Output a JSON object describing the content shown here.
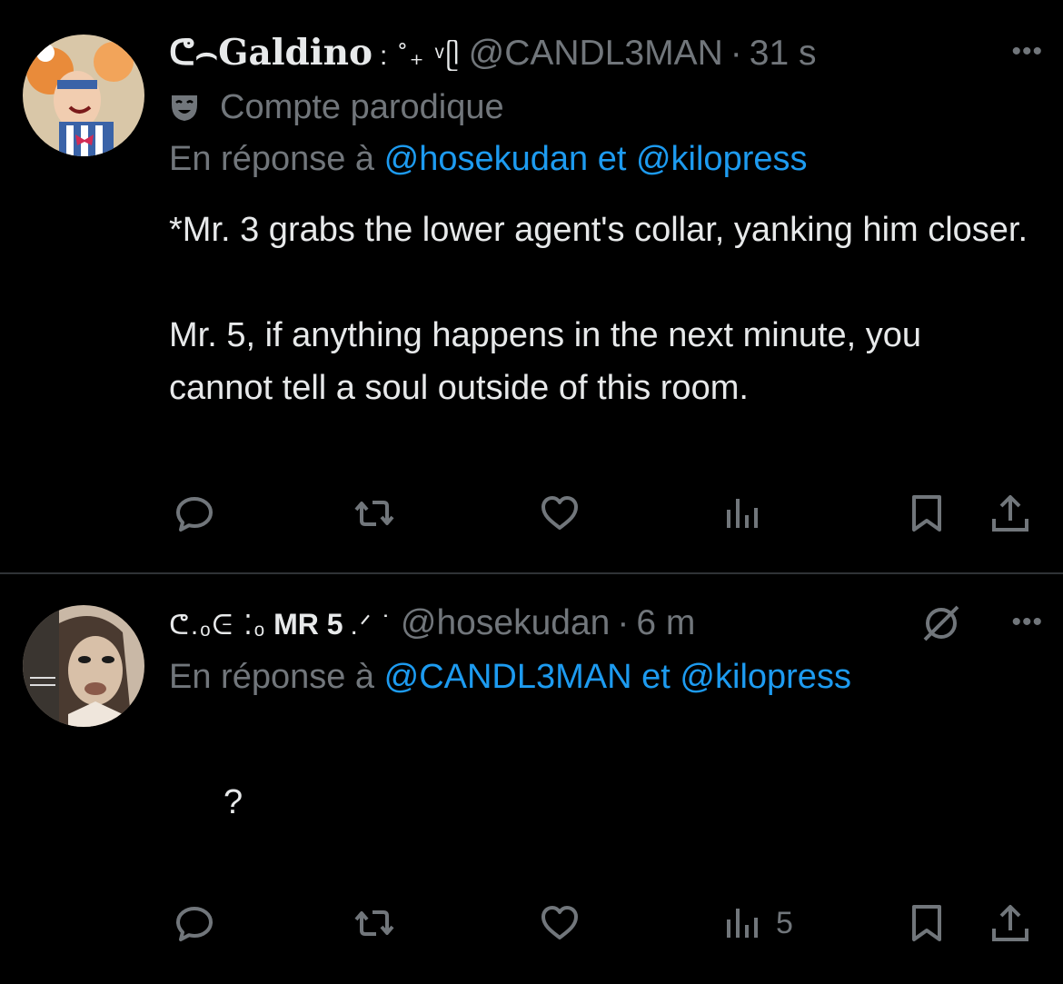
{
  "tweets": [
    {
      "display_name": "Galdino",
      "name_prefix": "ᕦ⌢",
      "name_suffix": ": ˚₊ ᵛᥫ",
      "handle": "@CANDL3MAN",
      "separator": "·",
      "time": "31 s",
      "more": "•••",
      "parody_label": "Compte parodique",
      "reply_prefix": "En réponse à",
      "reply_user_1": "@hosekudan",
      "reply_and": "et",
      "reply_user_2": "@kilopress",
      "text": "*Mr. 3 grabs the lower agent's collar, yanking him closer.\n\nMr. 5, if anything happens in the next minute, you cannot tell a soul outside of this room.",
      "icons": [
        "reply-icon",
        "retweet-icon",
        "like-icon",
        "views-icon",
        "bookmark-icon",
        "share-icon"
      ],
      "views_count": ""
    },
    {
      "display_name": "MR 5",
      "name_prefix": "ᕦ.ₒᕮ ⁚ₒ",
      "name_suffix": ".ᐟ ˙",
      "handle": "@hosekudan",
      "separator": "·",
      "time": "6 m",
      "more": "•••",
      "reply_prefix": "En réponse à",
      "reply_user_1": "@CANDL3MAN",
      "reply_and": "et",
      "reply_user_2": "@kilopress",
      "text": "?",
      "icons": [
        "reply-icon",
        "retweet-icon",
        "like-icon",
        "views-icon",
        "bookmark-icon",
        "share-icon",
        "grok-icon"
      ],
      "views_count": "5"
    }
  ],
  "colors": {
    "background": "#000000",
    "text": "#e7e9ea",
    "muted": "#71767b",
    "link": "#1d9bf0",
    "divider": "#2f3336"
  }
}
